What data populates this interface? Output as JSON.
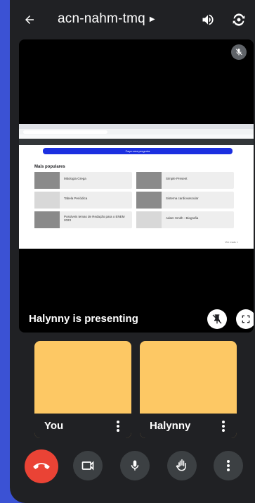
{
  "header": {
    "meeting_code": "acn-nahm-tmq"
  },
  "stage": {
    "presenting_text": "Halynny is presenting",
    "shared_page": {
      "ask_button": "Faça uma pergunta",
      "section_title": "Mais populares",
      "items": [
        "Mitologia Grega",
        "Simple Present",
        "Tabela Periódica",
        "Sistema cardiovascular",
        "Possíveis temas de Redação para o ENEM 2023",
        "Adam Smith - Biografia"
      ],
      "see_more": "Ver mais »"
    }
  },
  "participants": [
    {
      "name": "You",
      "tile_color": "#fdc864"
    },
    {
      "name": "Halynny",
      "tile_color": "#fdc864"
    }
  ],
  "colors": {
    "background": "#202124",
    "accent_frame": "#3b52d4",
    "end_call": "#ea4335",
    "control": "#3c4043"
  },
  "icons": {
    "back": "arrow-left-icon",
    "speaker": "speaker-icon",
    "camera_switch": "camera-switch-icon",
    "end_call": "phone-hangup-icon",
    "camera": "video-camera-icon",
    "mic": "microphone-icon",
    "hand": "raise-hand-icon",
    "more": "more-vertical-icon"
  }
}
